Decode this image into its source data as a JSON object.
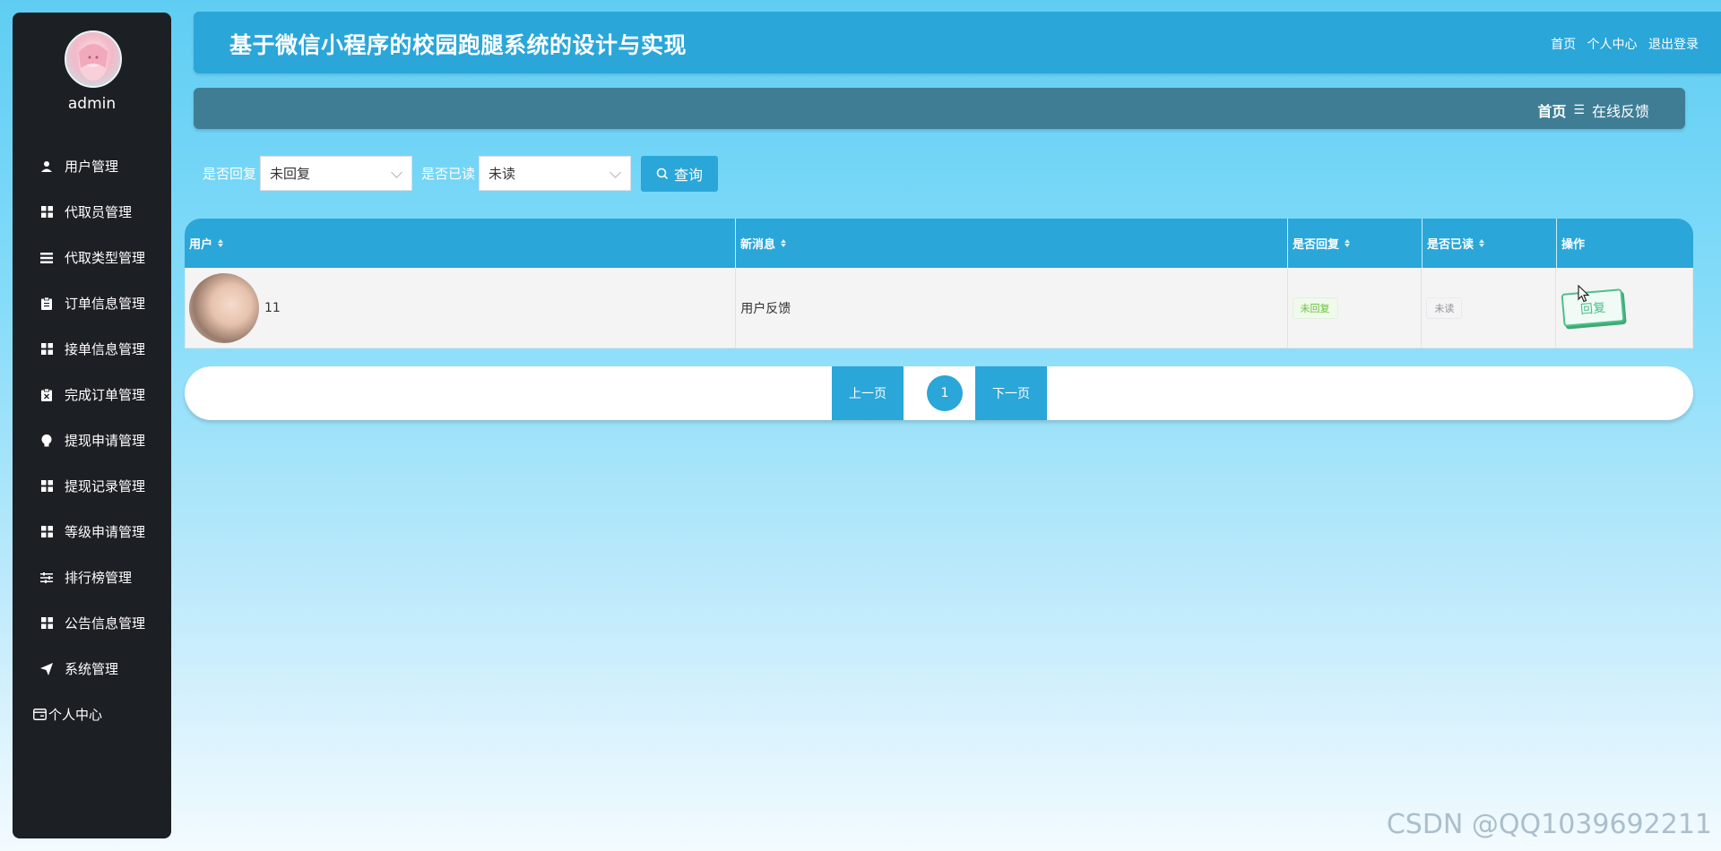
{
  "sidebar": {
    "username": "admin",
    "items": [
      {
        "label": "用户管理",
        "icon": "user-icon"
      },
      {
        "label": "代取员管理",
        "icon": "grid-icon"
      },
      {
        "label": "代取类型管理",
        "icon": "list-icon"
      },
      {
        "label": "订单信息管理",
        "icon": "clipboard-icon"
      },
      {
        "label": "接单信息管理",
        "icon": "grid-icon"
      },
      {
        "label": "完成订单管理",
        "icon": "clipboard-x-icon"
      },
      {
        "label": "提现申请管理",
        "icon": "bulb-icon"
      },
      {
        "label": "提现记录管理",
        "icon": "grid-icon"
      },
      {
        "label": "等级申请管理",
        "icon": "grid-icon"
      },
      {
        "label": "排行榜管理",
        "icon": "sliders-icon"
      },
      {
        "label": "公告信息管理",
        "icon": "grid-icon"
      },
      {
        "label": "系统管理",
        "icon": "send-icon"
      },
      {
        "label": "个人中心",
        "icon": "card-icon"
      }
    ]
  },
  "header": {
    "title": "基于微信小程序的校园跑腿系统的设计与实现",
    "links": [
      "首页",
      "个人中心",
      "退出登录"
    ]
  },
  "breadcrumb": {
    "home": "首页",
    "separator": "☰",
    "current": "在线反馈"
  },
  "filters": {
    "reply_label": "是否回复",
    "reply_value": "未回复",
    "read_label": "是否已读",
    "read_value": "未读",
    "query_label": "查询"
  },
  "table": {
    "columns": [
      "用户",
      "新消息",
      "是否回复",
      "是否已读",
      "操作"
    ],
    "rows": [
      {
        "user": "11",
        "message": "用户反馈",
        "replied": "未回复",
        "read": "未读",
        "action": "回复"
      }
    ]
  },
  "pagination": {
    "prev_label": "上一页",
    "current_page": "1",
    "next_label": "下一页"
  },
  "watermark": "CSDN @QQ1039692211",
  "colors": {
    "primary": "#2aa6d9",
    "sidebar_bg": "#1c1f24",
    "crumbbar_bg": "#3f7d94",
    "success": "#67c23a",
    "reply_green": "#4cc08a"
  }
}
